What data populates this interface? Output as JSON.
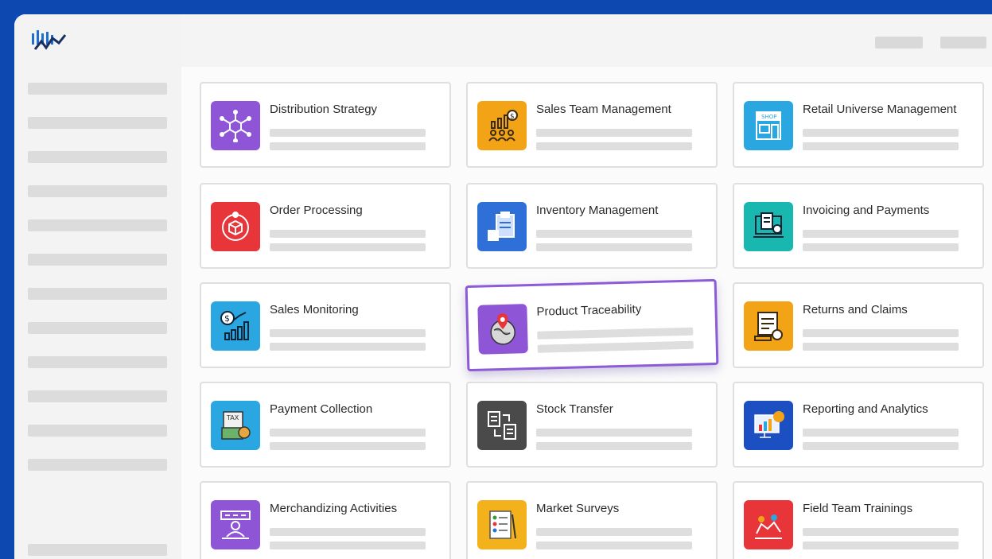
{
  "colors": {
    "frame": "#0d47b0",
    "card_highlight": "#8d5bd6"
  },
  "logo": {
    "icon": "brand-logo-icon"
  },
  "modules": [
    {
      "title": "Distribution Strategy",
      "icon": "network-cube-icon",
      "color": "#8e56d6"
    },
    {
      "title": "Sales Team Management",
      "icon": "team-growth-icon",
      "color": "#f3a316"
    },
    {
      "title": "Retail Universe Management",
      "icon": "shop-icon",
      "color": "#2aa7e0"
    },
    {
      "title": "Order Processing",
      "icon": "order-box-icon",
      "color": "#e8353a"
    },
    {
      "title": "Inventory Management",
      "icon": "clipboard-boxes-icon",
      "color": "#2f6fd8"
    },
    {
      "title": "Invoicing and Payments",
      "icon": "invoice-screen-icon",
      "color": "#18b7b0"
    },
    {
      "title": "Sales Monitoring",
      "icon": "money-chart-icon",
      "color": "#2aa7e0"
    },
    {
      "title": "Product Traceability",
      "icon": "globe-pin-icon",
      "color": "#8e56d6"
    },
    {
      "title": "Returns and Claims",
      "icon": "document-stamp-icon",
      "color": "#f3a316"
    },
    {
      "title": "Payment Collection",
      "icon": "tax-payment-icon",
      "color": "#2aa7e0"
    },
    {
      "title": "Stock Transfer",
      "icon": "transfer-docs-icon",
      "color": "#4a4a4a"
    },
    {
      "title": "Reporting and Analytics",
      "icon": "analytics-screen-icon",
      "color": "#1b4fc2"
    },
    {
      "title": "Merchandizing Activities",
      "icon": "presenter-board-icon",
      "color": "#8e56d6"
    },
    {
      "title": "Market Surveys",
      "icon": "survey-checklist-icon",
      "color": "#f3b21c"
    },
    {
      "title": "Field Team Trainings",
      "icon": "team-training-icon",
      "color": "#e8353a"
    }
  ]
}
